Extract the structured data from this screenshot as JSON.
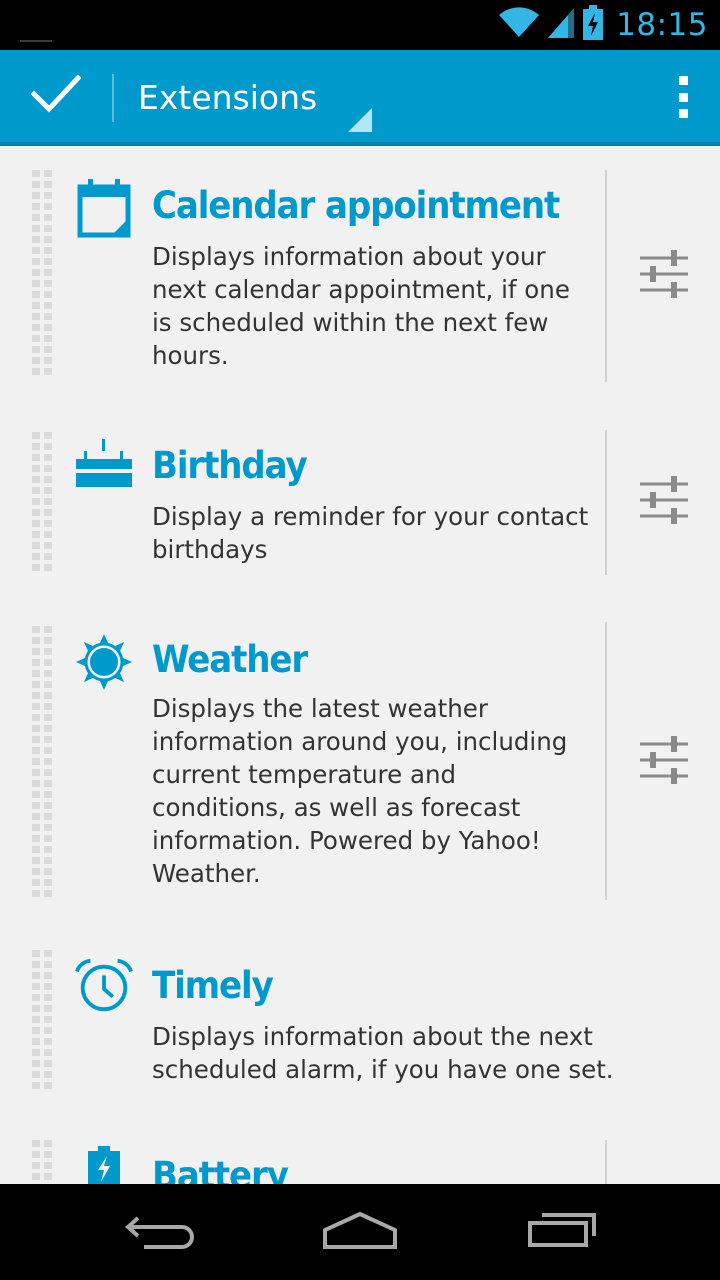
{
  "status_bar": {
    "time": "18:15",
    "icons": [
      "wifi-icon",
      "cell-signal-icon",
      "battery-charging-icon"
    ],
    "accent": "#33b5e5"
  },
  "action_bar": {
    "title": "Extensions",
    "done_icon": "check-icon",
    "overflow_icon": "overflow-menu-icon",
    "background": "#0099cc"
  },
  "extensions": [
    {
      "icon": "calendar-icon",
      "title": "Calendar appointment",
      "description": "Displays information about your next calendar appointment, if one is scheduled within the next few hours.",
      "has_settings": true
    },
    {
      "icon": "birthday-cake-icon",
      "title": "Birthday",
      "description": "Display a reminder for your contact birthdays",
      "has_settings": true
    },
    {
      "icon": "sun-icon",
      "title": "Weather",
      "description": "Displays the latest weather information around you, including current temperature and conditions, as well as forecast information. Powered by Yahoo! Weather.",
      "has_settings": true
    },
    {
      "icon": "alarm-clock-icon",
      "title": "Timely",
      "description": "Displays information about the next scheduled alarm, if you have one set.",
      "has_settings": false
    },
    {
      "icon": "battery-icon",
      "title": "Battery",
      "description": "",
      "has_settings": true
    }
  ],
  "nav_bar": {
    "buttons": [
      "back-icon",
      "home-icon",
      "recent-apps-icon"
    ]
  },
  "colors": {
    "accent": "#0099cc",
    "text": "#333333",
    "background": "#f1f1f1"
  }
}
